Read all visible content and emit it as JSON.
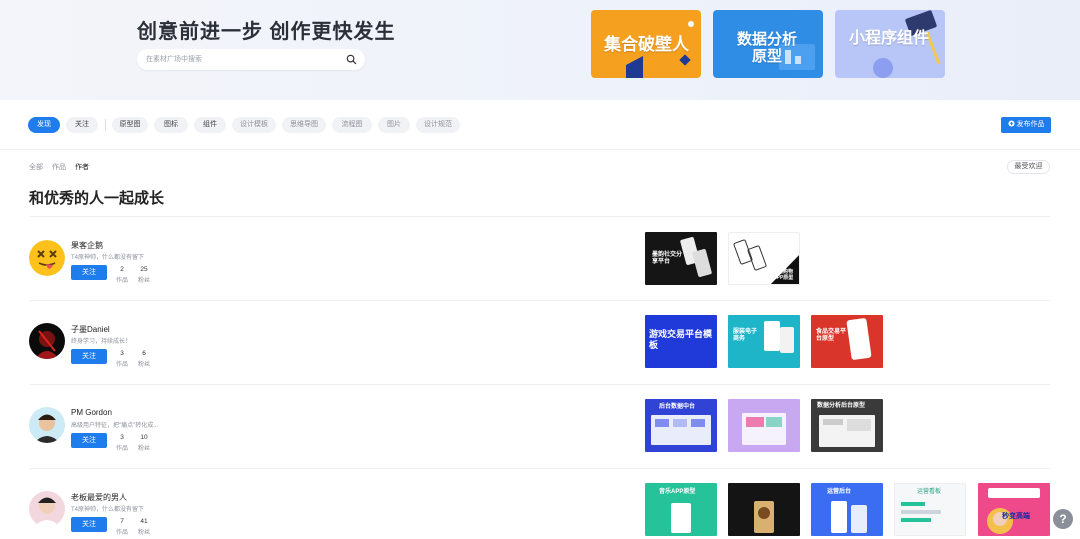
{
  "hero": {
    "title": "创意前进一步  创作更快发生",
    "search_placeholder": "在素材广场中搜索",
    "banners": [
      "集合破壁人",
      "数据分析原型",
      "小程序组件"
    ],
    "banner_colors": [
      "#f6a01f",
      "#2f8de6",
      "#b7c6f7"
    ]
  },
  "filters": {
    "tabs": [
      "发现",
      "关注"
    ],
    "categories": [
      "原型图",
      "图标",
      "组件",
      "设计模板",
      "思维导图",
      "流程图",
      "图片",
      "设计规范"
    ],
    "publish_label": "发布作品"
  },
  "breadcrumb": [
    "全部",
    "作品",
    "作者"
  ],
  "sort_label": "最受欢迎",
  "section_title": "和优秀的人一起成长",
  "follow_label": "关注",
  "stat_labels": {
    "works": "作品",
    "fans": "粉丝"
  },
  "users": [
    {
      "name": "果客企鹅",
      "desc": "T4原神帅，什么都没有留下",
      "works": "2",
      "fans": "25",
      "thumbs": [
        "墨韵社交分享平台",
        "电商购物APP原型"
      ]
    },
    {
      "name": "子墨Daniel",
      "desc": "终身学习，持续成长！",
      "works": "3",
      "fans": "6",
      "thumbs": [
        "游戏交易平台模板",
        "服装电子商务",
        "食品交易平台原型"
      ]
    },
    {
      "name": "PM Gordon",
      "desc": "高级用户特征，把\"痛点\"转化成...",
      "works": "3",
      "fans": "10",
      "thumbs": [
        "后台数据中台",
        "",
        "数据分析后台原型"
      ]
    },
    {
      "name": "老板最爱的男人",
      "desc": "T4原神帅，什么都没有留下",
      "works": "7",
      "fans": "41",
      "thumbs": [
        "音乐APP原型",
        "",
        "运营后台",
        "运营看板",
        "秒变高端"
      ]
    }
  ],
  "help_label": "?",
  "accent": "#1f7cec"
}
